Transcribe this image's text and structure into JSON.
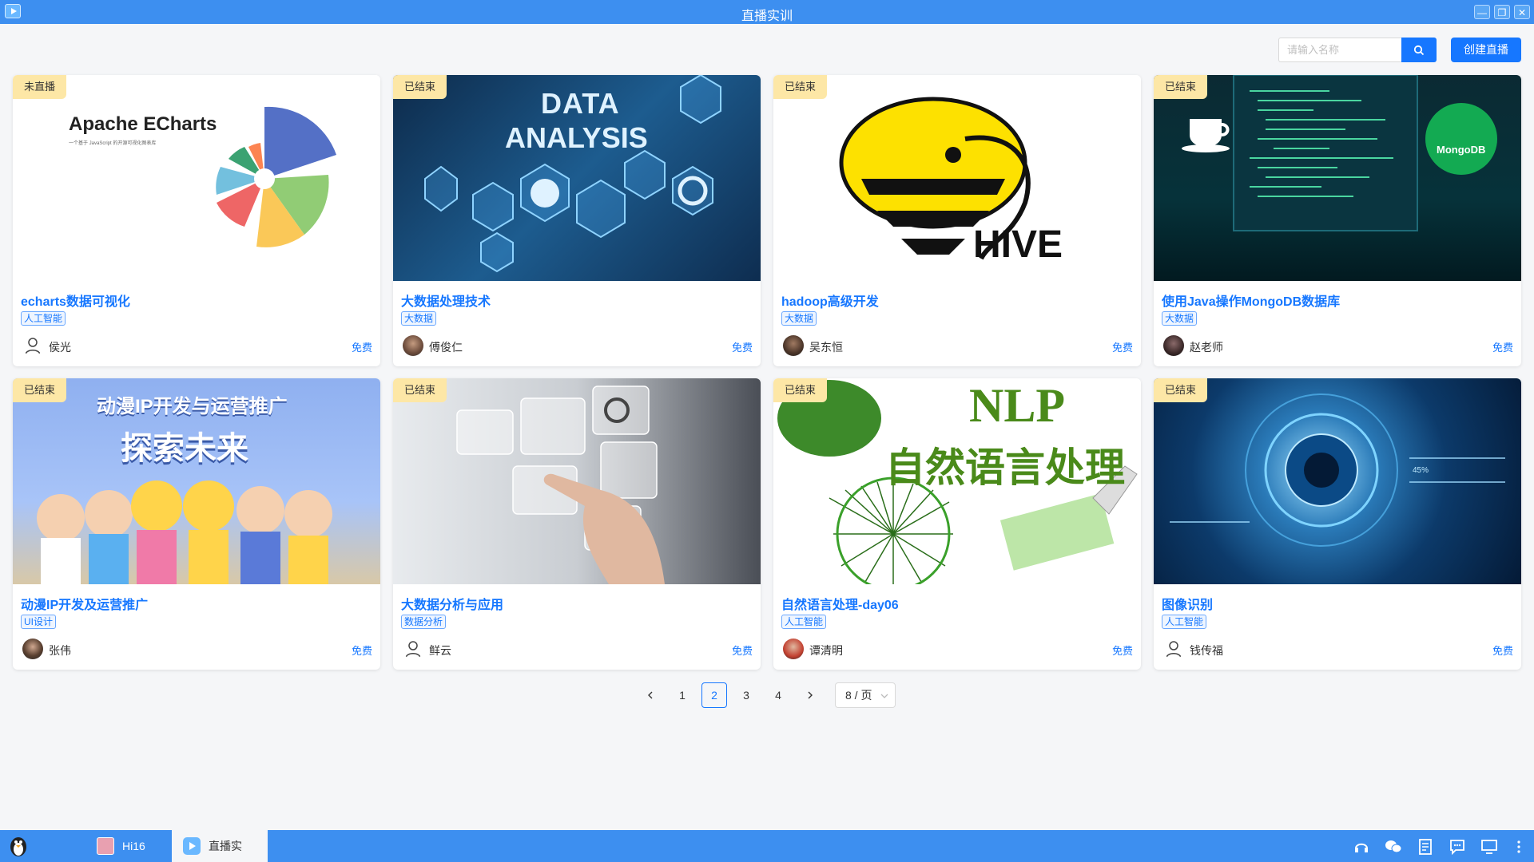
{
  "window": {
    "title": "直播实训"
  },
  "toolbar": {
    "search_placeholder": "请输入名称",
    "create_label": "创建直播"
  },
  "cards": [
    {
      "status": "未直播",
      "title": "echarts数据可视化",
      "category": "人工智能",
      "author": "侯光",
      "price": "免费",
      "thumb_text_1": "Apache ECharts",
      "thumb_text_2": "一个基于 JavaScript 的开源可视化图表库"
    },
    {
      "status": "已结束",
      "title": "大数据处理技术",
      "category": "大数据",
      "author": "傅俊仁",
      "price": "免费",
      "thumb_text_1": "DATA",
      "thumb_text_2": "ANALYSIS"
    },
    {
      "status": "已结束",
      "title": "hadoop高级开发",
      "category": "大数据",
      "author": "吴东恒",
      "price": "免费",
      "thumb_text_1": "HIVE"
    },
    {
      "status": "已结束",
      "title": "使用Java操作MongoDB数据库",
      "category": "大数据",
      "author": "赵老师",
      "price": "免费",
      "thumb_text_1": "MongoDB"
    },
    {
      "status": "已结束",
      "title": "动漫IP开发及运营推广",
      "category": "UI设计",
      "author": "张伟",
      "price": "免费",
      "thumb_text_1": "动漫IP开发与运营推广",
      "thumb_text_2": "探索未来"
    },
    {
      "status": "已结束",
      "title": "大数据分析与应用",
      "category": "数据分析",
      "author": "鲜云",
      "price": "免费"
    },
    {
      "status": "已结束",
      "title": "自然语言处理-day06",
      "category": "人工智能",
      "author": "谭清明",
      "price": "免费",
      "thumb_text_1": "NLP",
      "thumb_text_2": "自然语言处理"
    },
    {
      "status": "已结束",
      "title": "图像识别",
      "category": "人工智能",
      "author": "钱传福",
      "price": "免费",
      "thumb_text_1": "45%"
    }
  ],
  "pagination": {
    "pages": [
      "1",
      "2",
      "3",
      "4"
    ],
    "current": "2",
    "page_size": "8 / 页"
  },
  "taskbar": {
    "items": [
      {
        "label": "Hi16"
      },
      {
        "label": "直播实"
      }
    ]
  },
  "colors": {
    "accent": "#1677ff",
    "titlebar": "#3d8ff0",
    "status_tag": "#fde7a6"
  }
}
